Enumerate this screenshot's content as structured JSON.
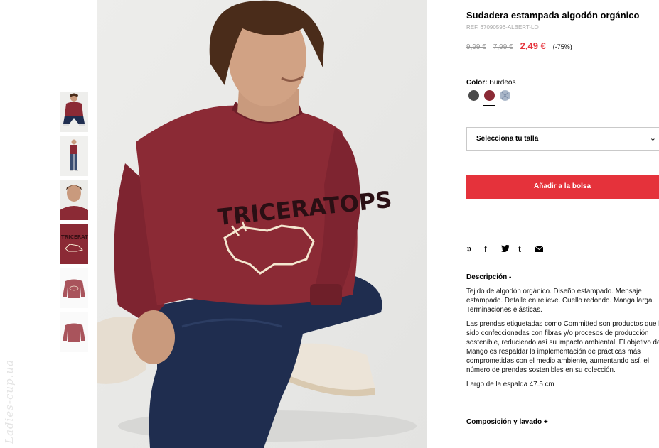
{
  "watermark": "Ladies-cup.ua",
  "product": {
    "title": "Sudadera estampada algodón orgánico",
    "ref": "REF. 67090596-ALBERT-LO",
    "price_original": "9,99 €",
    "price_previous": "7,99 €",
    "price_current": "2,49 €",
    "discount": "(-75%)"
  },
  "color": {
    "label": "Color:",
    "value": "Burdeos",
    "swatches": [
      {
        "name": "gris oscuro",
        "hex": "#4a4a4a",
        "selected": false
      },
      {
        "name": "burdeos",
        "hex": "#8b2a35",
        "selected": true
      },
      {
        "name": "azul claro",
        "hex": "#a9b6c8",
        "selected": false
      }
    ]
  },
  "size_select": {
    "label": "Selecciona tu talla",
    "chevron": "chevron-down-icon"
  },
  "add_button": {
    "label": "Añadir a la bolsa"
  },
  "share": [
    "pinterest-icon",
    "facebook-icon",
    "twitter-icon",
    "tumblr-icon",
    "email-icon"
  ],
  "description": {
    "heading": "Descripción -",
    "paragraphs": [
      "Tejido de algodón orgánico. Diseño estampado. Mensaje estampado. Detalle en relieve. Cuello redondo. Manga larga. Terminaciones elásticas.",
      "Las prendas etiquetadas como Committed son productos que han sido confeccionadas con fibras y/o procesos de producción sostenible, reduciendo así su impacto ambiental. El objetivo de Mango es respaldar la implementación de prácticas más comprometidas con el medio ambiente, aumentando así, el número de prendas sostenibles en su colección.",
      "Largo de la espalda 47.5 cm"
    ]
  },
  "composition": {
    "heading": "Composición y lavado +"
  },
  "graphic": {
    "sweater_text": "TRICERATOPS"
  },
  "colors": {
    "accent": "#e5323b",
    "sweater": "#8b2a35",
    "jeans": "#1f2d4f"
  }
}
